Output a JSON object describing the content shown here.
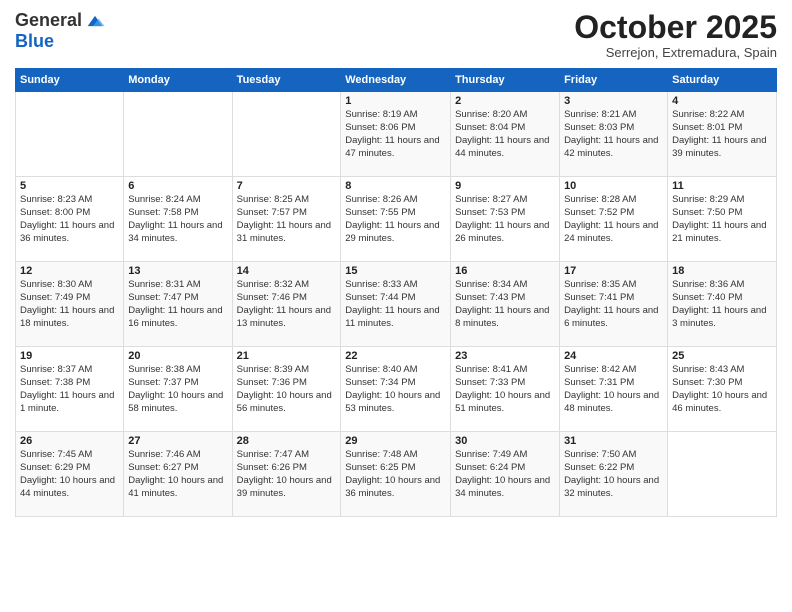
{
  "logo": {
    "general": "General",
    "blue": "Blue"
  },
  "title": "October 2025",
  "location": "Serrejon, Extremadura, Spain",
  "days_of_week": [
    "Sunday",
    "Monday",
    "Tuesday",
    "Wednesday",
    "Thursday",
    "Friday",
    "Saturday"
  ],
  "weeks": [
    [
      {
        "day": "",
        "info": ""
      },
      {
        "day": "",
        "info": ""
      },
      {
        "day": "",
        "info": ""
      },
      {
        "day": "1",
        "info": "Sunrise: 8:19 AM\nSunset: 8:06 PM\nDaylight: 11 hours and 47 minutes."
      },
      {
        "day": "2",
        "info": "Sunrise: 8:20 AM\nSunset: 8:04 PM\nDaylight: 11 hours and 44 minutes."
      },
      {
        "day": "3",
        "info": "Sunrise: 8:21 AM\nSunset: 8:03 PM\nDaylight: 11 hours and 42 minutes."
      },
      {
        "day": "4",
        "info": "Sunrise: 8:22 AM\nSunset: 8:01 PM\nDaylight: 11 hours and 39 minutes."
      }
    ],
    [
      {
        "day": "5",
        "info": "Sunrise: 8:23 AM\nSunset: 8:00 PM\nDaylight: 11 hours and 36 minutes."
      },
      {
        "day": "6",
        "info": "Sunrise: 8:24 AM\nSunset: 7:58 PM\nDaylight: 11 hours and 34 minutes."
      },
      {
        "day": "7",
        "info": "Sunrise: 8:25 AM\nSunset: 7:57 PM\nDaylight: 11 hours and 31 minutes."
      },
      {
        "day": "8",
        "info": "Sunrise: 8:26 AM\nSunset: 7:55 PM\nDaylight: 11 hours and 29 minutes."
      },
      {
        "day": "9",
        "info": "Sunrise: 8:27 AM\nSunset: 7:53 PM\nDaylight: 11 hours and 26 minutes."
      },
      {
        "day": "10",
        "info": "Sunrise: 8:28 AM\nSunset: 7:52 PM\nDaylight: 11 hours and 24 minutes."
      },
      {
        "day": "11",
        "info": "Sunrise: 8:29 AM\nSunset: 7:50 PM\nDaylight: 11 hours and 21 minutes."
      }
    ],
    [
      {
        "day": "12",
        "info": "Sunrise: 8:30 AM\nSunset: 7:49 PM\nDaylight: 11 hours and 18 minutes."
      },
      {
        "day": "13",
        "info": "Sunrise: 8:31 AM\nSunset: 7:47 PM\nDaylight: 11 hours and 16 minutes."
      },
      {
        "day": "14",
        "info": "Sunrise: 8:32 AM\nSunset: 7:46 PM\nDaylight: 11 hours and 13 minutes."
      },
      {
        "day": "15",
        "info": "Sunrise: 8:33 AM\nSunset: 7:44 PM\nDaylight: 11 hours and 11 minutes."
      },
      {
        "day": "16",
        "info": "Sunrise: 8:34 AM\nSunset: 7:43 PM\nDaylight: 11 hours and 8 minutes."
      },
      {
        "day": "17",
        "info": "Sunrise: 8:35 AM\nSunset: 7:41 PM\nDaylight: 11 hours and 6 minutes."
      },
      {
        "day": "18",
        "info": "Sunrise: 8:36 AM\nSunset: 7:40 PM\nDaylight: 11 hours and 3 minutes."
      }
    ],
    [
      {
        "day": "19",
        "info": "Sunrise: 8:37 AM\nSunset: 7:38 PM\nDaylight: 11 hours and 1 minute."
      },
      {
        "day": "20",
        "info": "Sunrise: 8:38 AM\nSunset: 7:37 PM\nDaylight: 10 hours and 58 minutes."
      },
      {
        "day": "21",
        "info": "Sunrise: 8:39 AM\nSunset: 7:36 PM\nDaylight: 10 hours and 56 minutes."
      },
      {
        "day": "22",
        "info": "Sunrise: 8:40 AM\nSunset: 7:34 PM\nDaylight: 10 hours and 53 minutes."
      },
      {
        "day": "23",
        "info": "Sunrise: 8:41 AM\nSunset: 7:33 PM\nDaylight: 10 hours and 51 minutes."
      },
      {
        "day": "24",
        "info": "Sunrise: 8:42 AM\nSunset: 7:31 PM\nDaylight: 10 hours and 48 minutes."
      },
      {
        "day": "25",
        "info": "Sunrise: 8:43 AM\nSunset: 7:30 PM\nDaylight: 10 hours and 46 minutes."
      }
    ],
    [
      {
        "day": "26",
        "info": "Sunrise: 7:45 AM\nSunset: 6:29 PM\nDaylight: 10 hours and 44 minutes."
      },
      {
        "day": "27",
        "info": "Sunrise: 7:46 AM\nSunset: 6:27 PM\nDaylight: 10 hours and 41 minutes."
      },
      {
        "day": "28",
        "info": "Sunrise: 7:47 AM\nSunset: 6:26 PM\nDaylight: 10 hours and 39 minutes."
      },
      {
        "day": "29",
        "info": "Sunrise: 7:48 AM\nSunset: 6:25 PM\nDaylight: 10 hours and 36 minutes."
      },
      {
        "day": "30",
        "info": "Sunrise: 7:49 AM\nSunset: 6:24 PM\nDaylight: 10 hours and 34 minutes."
      },
      {
        "day": "31",
        "info": "Sunrise: 7:50 AM\nSunset: 6:22 PM\nDaylight: 10 hours and 32 minutes."
      },
      {
        "day": "",
        "info": ""
      }
    ]
  ]
}
